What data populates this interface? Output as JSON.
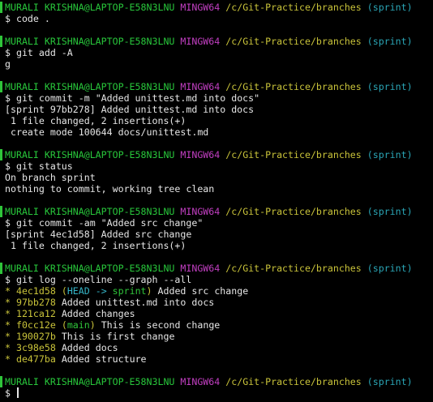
{
  "prompt": {
    "user_host": "MURALI KRISHNA@LAPTOP-E58N3LNU",
    "shell": "MINGW64",
    "path": "/c/Git-Practice/branches",
    "branch": "(sprint)",
    "symbol": "$"
  },
  "blocks": [
    {
      "command": "code .",
      "output": []
    },
    {
      "command": "git add -A",
      "output": [
        "g"
      ]
    },
    {
      "command": "git commit -m \"Added unittest.md into docs\"",
      "output": [
        "[sprint 97bb278] Added unittest.md into docs",
        " 1 file changed, 2 insertions(+)",
        " create mode 100644 docs/unittest.md"
      ]
    },
    {
      "command": "git status",
      "output": [
        "On branch sprint",
        "nothing to commit, working tree clean"
      ]
    },
    {
      "command": "git commit -am \"Added src change\"",
      "output": [
        "[sprint 4ec1d58] Added src change",
        " 1 file changed, 2 insertions(+)"
      ]
    },
    {
      "command": "git log --oneline --graph --all",
      "log": [
        {
          "graph": "*",
          "hash": "4ec1d58",
          "ref_open": "(",
          "ref_head": "HEAD -> ",
          "ref_branch": "sprint",
          "ref_close": ")",
          "message": "Added src change"
        },
        {
          "graph": "*",
          "hash": "97bb278",
          "message": "Added unittest.md into docs"
        },
        {
          "graph": "*",
          "hash": "121ca12",
          "message": "Added changes"
        },
        {
          "graph": "*",
          "hash": "f0cc12e",
          "ref_open": "(",
          "ref_head": "",
          "ref_branch": "main",
          "ref_close": ")",
          "message": "This is second change"
        },
        {
          "graph": "*",
          "hash": "190027b",
          "message": "This is first change"
        },
        {
          "graph": "*",
          "hash": "3c98e58",
          "message": "Added docs"
        },
        {
          "graph": "*",
          "hash": "de477ba",
          "message": "Added structure"
        }
      ]
    },
    {
      "command": "",
      "output": [],
      "cursor": true
    }
  ],
  "colors": {
    "background": "#000000",
    "user_host": "#28c73b",
    "shell": "#c23fc2",
    "path": "#c9c33a",
    "branch": "#2aa6b6",
    "text": "#e6e6e6"
  }
}
